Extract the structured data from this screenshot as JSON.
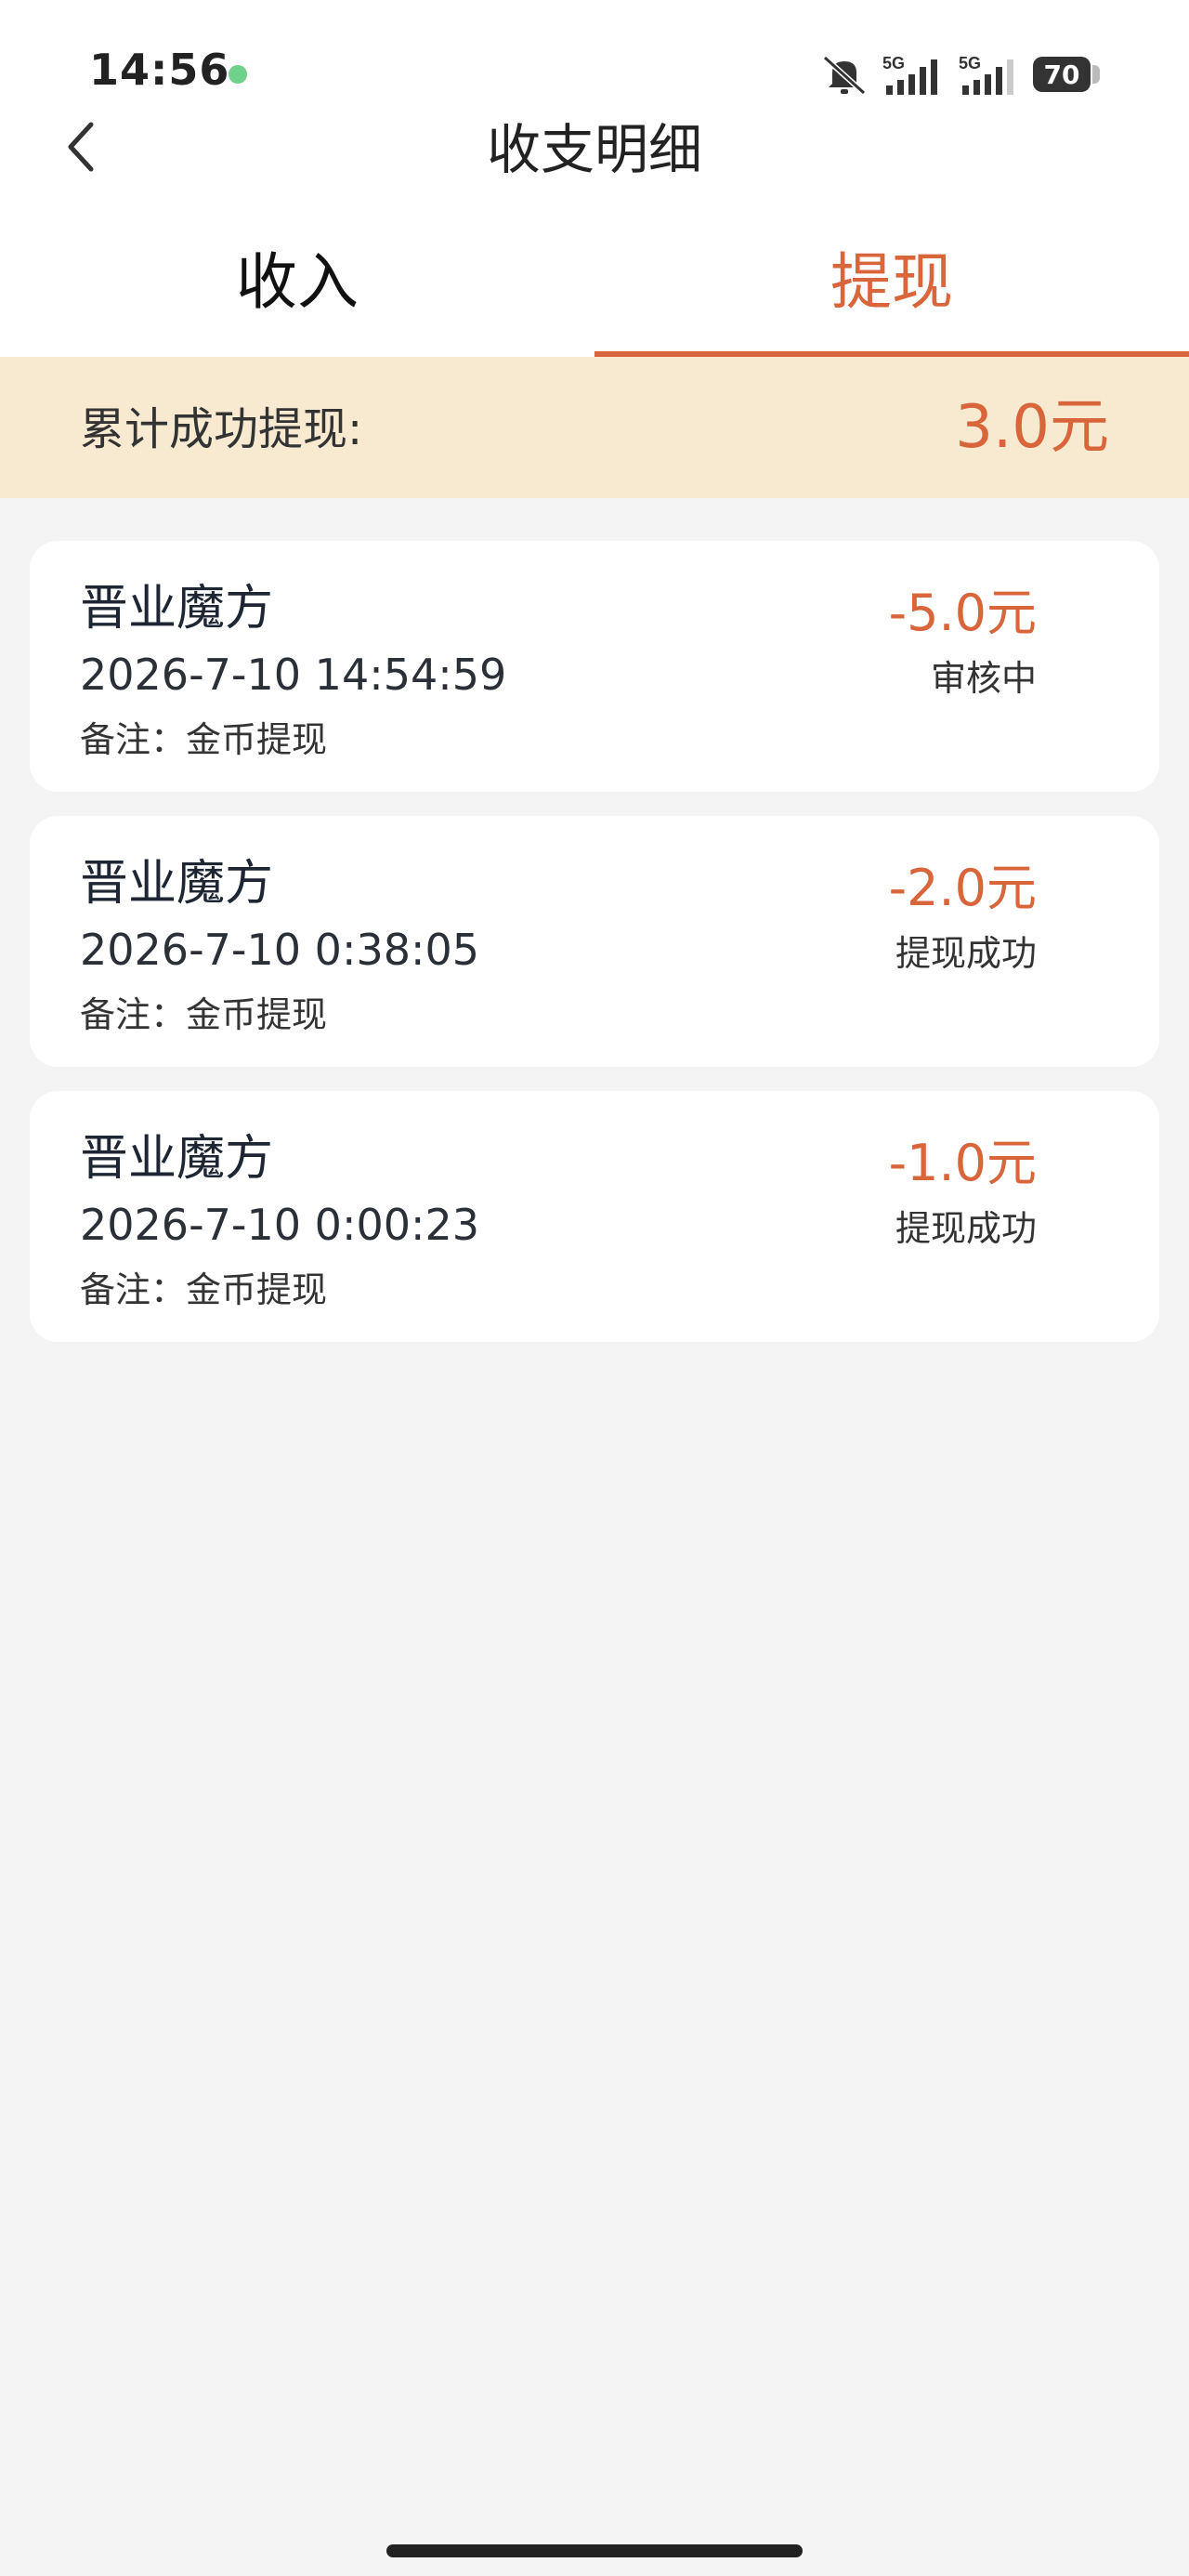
{
  "status_bar": {
    "time": "14:56",
    "signal_1": "5G",
    "signal_2": "5G",
    "battery": "70"
  },
  "header": {
    "title": "收支明细"
  },
  "tabs": [
    {
      "label": "收入",
      "active": false
    },
    {
      "label": "提现",
      "active": true
    }
  ],
  "summary": {
    "label": "累计成功提现:",
    "value": "3.0元"
  },
  "records": [
    {
      "name": "晋业魔方",
      "time": "2026-7-10 14:54:59",
      "note": "备注：金币提现",
      "amount": "-5.0元",
      "status": "审核中"
    },
    {
      "name": "晋业魔方",
      "time": "2026-7-10 0:38:05",
      "note": "备注：金币提现",
      "amount": "-2.0元",
      "status": "提现成功"
    },
    {
      "name": "晋业魔方",
      "time": "2026-7-10 0:00:23",
      "note": "备注：金币提现",
      "amount": "-1.0元",
      "status": "提现成功"
    }
  ],
  "colors": {
    "accent": "#d9653a",
    "banner": "#f7ead0",
    "background": "#f4f4f4"
  }
}
